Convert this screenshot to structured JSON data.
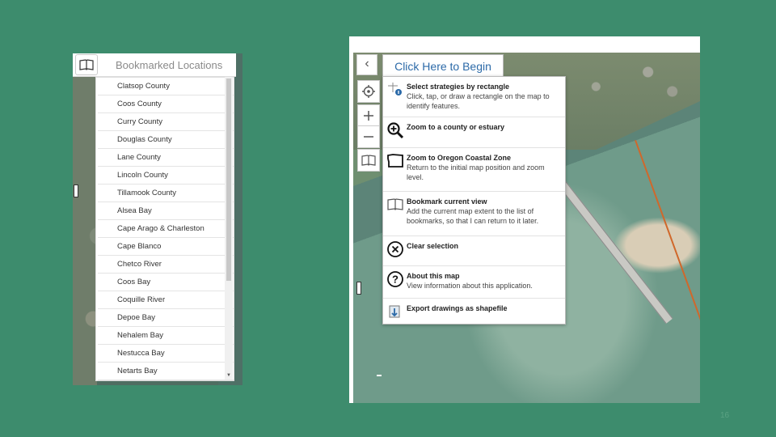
{
  "bookmarks_panel": {
    "title": "Bookmarked Locations",
    "items": [
      "Clatsop County",
      "Coos County",
      "Curry County",
      "Douglas County",
      "Lane County",
      "Lincoln County",
      "Tillamook County",
      "Alsea Bay",
      "Cape Arago & Charleston",
      "Cape Blanco",
      "Chetco River",
      "Coos Bay",
      "Coquille River",
      "Depoe Bay",
      "Nehalem Bay",
      "Nestucca Bay",
      "Netarts Bay"
    ]
  },
  "map_app": {
    "begin_button": "Click Here to Begin",
    "menu": [
      {
        "icon": "select-rectangle-icon",
        "title": "Select strategies by rectangle",
        "desc": "Click, tap, or draw a rectangle on the map to identify features."
      },
      {
        "icon": "zoom-in-icon",
        "title": "Zoom to a county or estuary",
        "desc": ""
      },
      {
        "icon": "oregon-shape-icon",
        "title": "Zoom to Oregon Coastal Zone",
        "desc": "Return to the initial map position and zoom level."
      },
      {
        "icon": "book-icon",
        "title": "Bookmark current view",
        "desc": "Add the current map extent to the list of bookmarks, so that I can return to it later."
      },
      {
        "icon": "close-circle-icon",
        "title": "Clear selection",
        "desc": ""
      },
      {
        "icon": "help-circle-icon",
        "title": "About this map",
        "desc": "View information about this application."
      },
      {
        "icon": "export-icon",
        "title": "Export drawings as shapefile",
        "desc": ""
      }
    ]
  },
  "slide": {
    "page_number": "16"
  },
  "colors": {
    "background": "#3d8c6d",
    "link_blue": "#2c6aa8",
    "cable_orange": "#d0682b"
  }
}
